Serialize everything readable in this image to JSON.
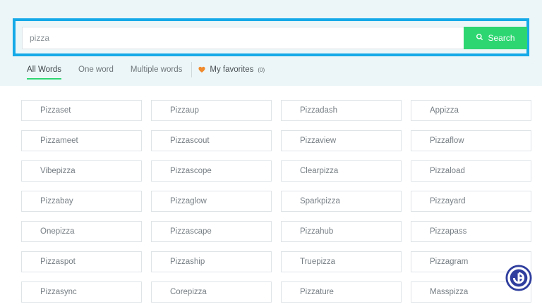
{
  "search": {
    "value": "pizza",
    "button_label": "Search",
    "icon": "search-icon"
  },
  "tabs": [
    {
      "label": "All Words",
      "active": true
    },
    {
      "label": "One word",
      "active": false
    },
    {
      "label": "Multiple words",
      "active": false
    }
  ],
  "favorites": {
    "label": "My favorites",
    "count": "(0)",
    "icon": "heart-icon"
  },
  "words": [
    {
      "text": "Pizzaset"
    },
    {
      "text": "Pizzaup"
    },
    {
      "text": "Pizzadash"
    },
    {
      "text": "Appizza"
    },
    {
      "text": "Pizzameet"
    },
    {
      "text": "Pizzascout"
    },
    {
      "text": "Pizzaview"
    },
    {
      "text": "Pizzaflow"
    },
    {
      "text": "Vibepizza"
    },
    {
      "text": "Pizzascope"
    },
    {
      "text": "Clearpizza"
    },
    {
      "text": "Pizzaload"
    },
    {
      "text": "Pizzabay"
    },
    {
      "text": "Pizzaglow"
    },
    {
      "text": "Sparkpizza"
    },
    {
      "text": "Pizzayard"
    },
    {
      "text": "Onepizza"
    },
    {
      "text": "Pizzascape"
    },
    {
      "text": "Pizzahub"
    },
    {
      "text": "Pizzapass"
    },
    {
      "text": "Pizzaspot"
    },
    {
      "text": "Pizzaship"
    },
    {
      "text": "Truepizza"
    },
    {
      "text": "Pizzagram"
    },
    {
      "text": "Pizzasync"
    },
    {
      "text": "Corepizza"
    },
    {
      "text": "Pizzature"
    },
    {
      "text": "Masspizza"
    }
  ],
  "colors": {
    "accent": "#2ed672",
    "highlight_border": "#16a9e8",
    "favorites_heart": "#f08a2c",
    "header_background": "#ecf6f8"
  },
  "badge": {
    "icon": "gamer-tweak-logo-icon"
  }
}
